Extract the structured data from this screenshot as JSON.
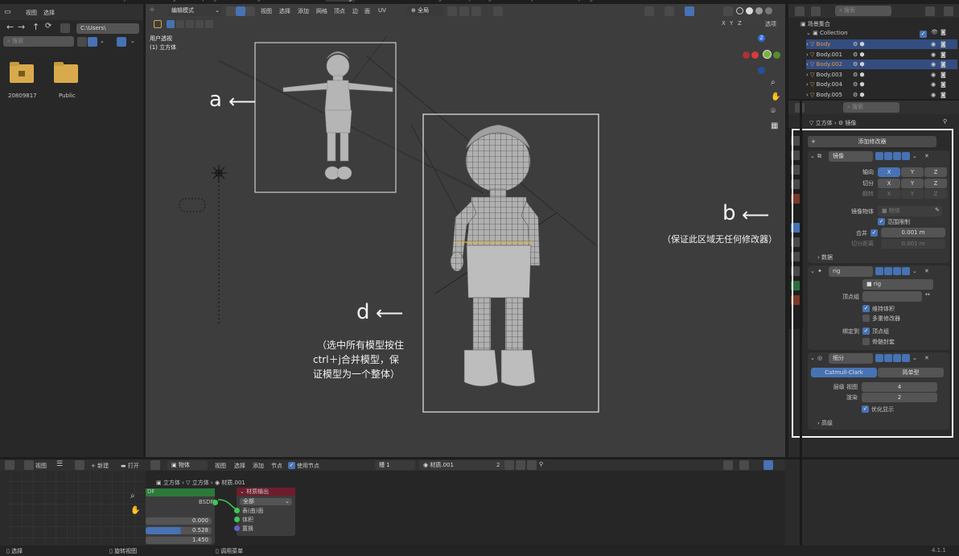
{
  "topbar": {
    "tabs": [
      "Layout",
      "Modeling",
      "Sculpting",
      "UV Editing",
      "Texture Paint",
      "Shading",
      "Animation",
      "Rendering",
      "Compositing",
      "Geometry Nodes",
      "Scripting"
    ]
  },
  "file_browser": {
    "menu": [
      "视图",
      "选择"
    ],
    "path": "C:\\Users\\",
    "search_placeholder": "搜索",
    "folders": [
      {
        "name": "20809817",
        "icon": "home-folder-icon"
      },
      {
        "name": "Public",
        "icon": "folder-icon"
      }
    ]
  },
  "viewport": {
    "mode": "编辑模式",
    "menu": [
      "视图",
      "选择",
      "添加",
      "网格",
      "顶点",
      "边",
      "面",
      "UV"
    ],
    "transform": "全局",
    "view_label": "用户透视",
    "object_label": "(1) 立方体",
    "axis_labels": [
      "X",
      "Y",
      "Z"
    ],
    "options_label": "选项",
    "annotation_a": "a",
    "annotation_d": "d",
    "annotation_d_note": [
      "（选中所有模型按住",
      "ctrl＋j合并模型，保",
      "证模型为一个整体）"
    ]
  },
  "annotation_b": {
    "letter": "b",
    "note": "（保证此区域无任何修改器）"
  },
  "outliner": {
    "search_placeholder": "搜索",
    "scene_collection": "场景集合",
    "collection": "Collection",
    "items": [
      "Body",
      "Body.001",
      "Body.002",
      "Body.003",
      "Body.004",
      "Body.005"
    ]
  },
  "properties": {
    "search_placeholder": "搜索",
    "breadcrumb": [
      "立方体",
      "镜像"
    ],
    "add_modifier": "添加修改器",
    "mirror": {
      "name": "镜像",
      "axis_label": "轴向",
      "bisect_label": "切分",
      "flip_label": "翻转",
      "axes": [
        "X",
        "Y",
        "Z"
      ],
      "mirror_object_label": "镜像物体",
      "mirror_object_placeholder": "物体",
      "clipping_label": "范围限制",
      "merge_label": "合并",
      "merge_value": "0.001 m",
      "bisect_distance_label": "切分距离",
      "bisect_distance_value": "0.001 m",
      "data_label": "数据"
    },
    "armature": {
      "name": "rig",
      "object_label": "物体",
      "object_value": "rig",
      "vertex_group_label": "顶点组",
      "preserve_volume": "维持体积",
      "multi_modifier": "多重修改器",
      "bind_to_label": "绑定到",
      "vertex_groups": "顶点组",
      "bone_envelopes": "骨骼封套"
    },
    "subdivision": {
      "name": "细分",
      "types": [
        "Catmull-Clark",
        "简单型"
      ],
      "levels_viewport_label": "层级 视图",
      "levels_viewport": "4",
      "render_label": "渲染",
      "render_value": "2",
      "optimal_display": "优化显示",
      "advanced": "高级"
    }
  },
  "uv_editor": {
    "menu": [
      "视图"
    ],
    "new_label": "新建",
    "open_label": "打开"
  },
  "node_editor": {
    "object_menu": "物体",
    "menu": [
      "视图",
      "选择",
      "添加",
      "节点"
    ],
    "use_nodes": "使用节点",
    "slot": "槽 1",
    "material": "材质.001",
    "users": "2",
    "breadcrumb": [
      "立方体",
      "立方体",
      "材质.001"
    ],
    "bsdf_label": "DF",
    "bsdf_socket": "BSDF",
    "bsdf_values": [
      "0.000",
      "0.528",
      "1.450"
    ],
    "output_node_title": "材质输出",
    "output_target": "全部",
    "output_sockets": [
      "表(曲)面",
      "体积",
      "置换"
    ]
  },
  "statusbar": {
    "left": "选择",
    "middle": "旋转视图",
    "right": "调用菜单",
    "version": "4.1.1"
  }
}
